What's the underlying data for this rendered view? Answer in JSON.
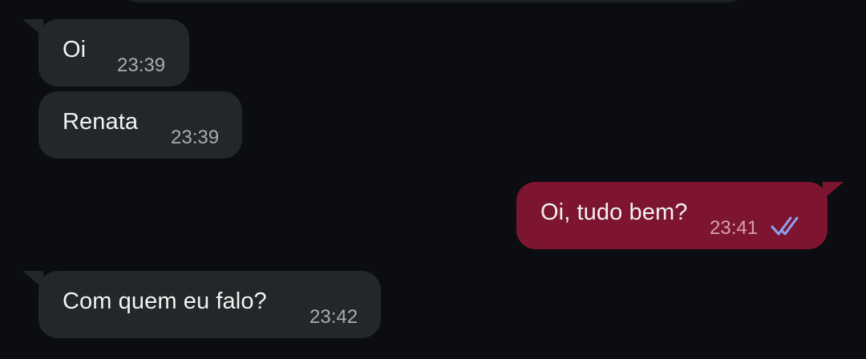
{
  "messages": [
    {
      "direction": "incoming",
      "text": "Oi",
      "time": "23:39"
    },
    {
      "direction": "incoming",
      "text": "Renata",
      "time": "23:39"
    },
    {
      "direction": "outgoing",
      "text": "Oi, tudo bem?",
      "time": "23:41",
      "status": "read",
      "status_icon": "double-check-icon",
      "status_color": "#8ea2f2"
    },
    {
      "direction": "incoming",
      "text": "Com quem eu falo?",
      "time": "23:42"
    }
  ],
  "colors": {
    "background": "#0b0d12",
    "incoming_bubble": "#232729",
    "outgoing_bubble": "#7d1530"
  }
}
